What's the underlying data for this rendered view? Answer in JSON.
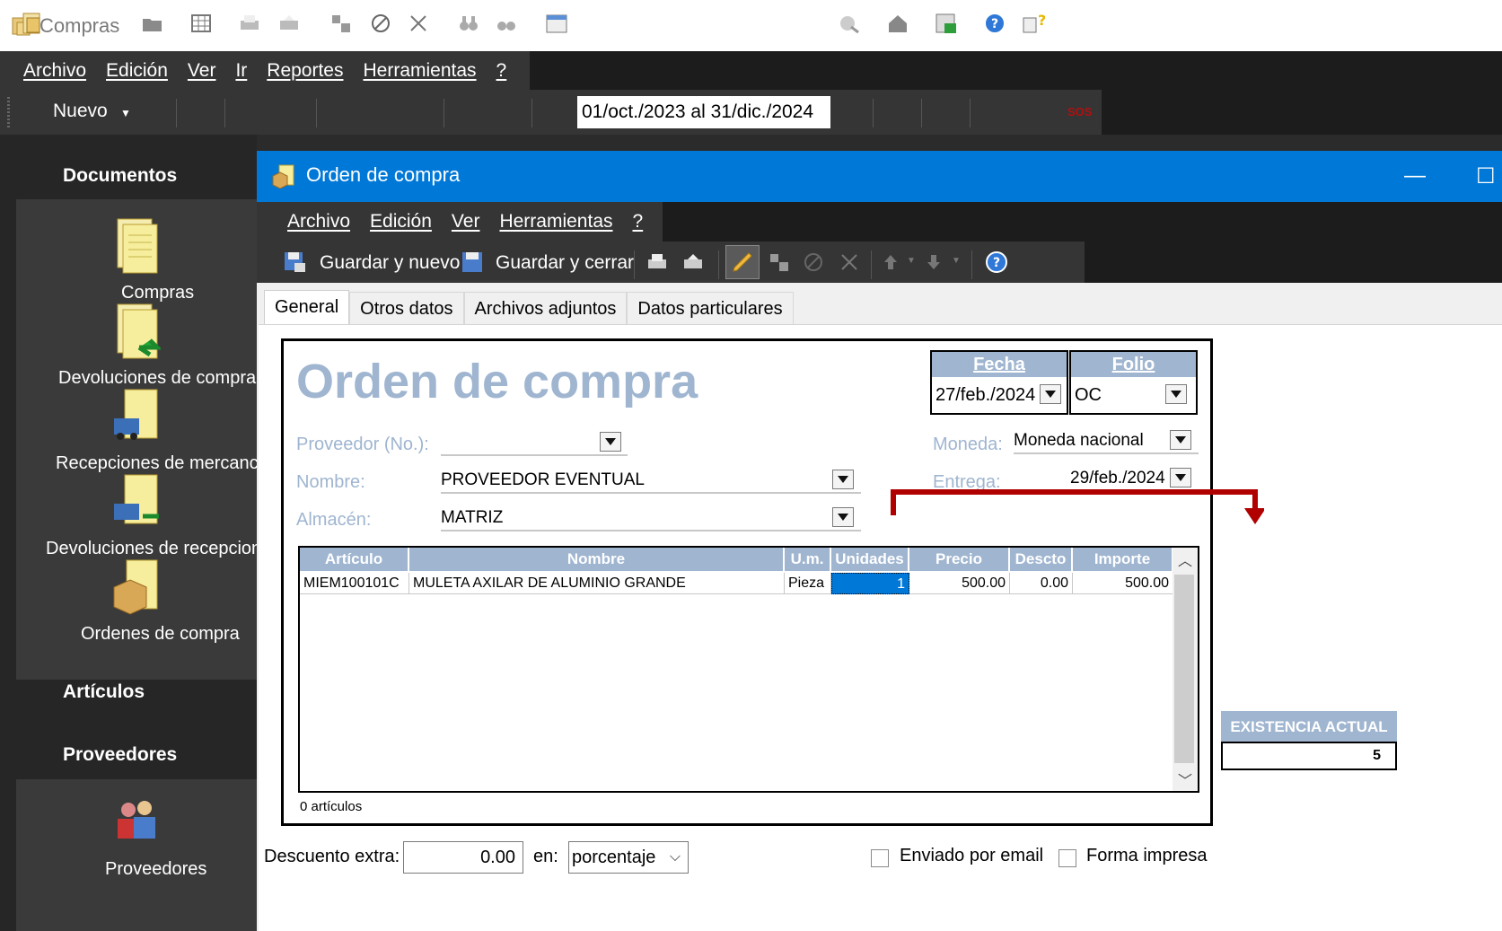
{
  "app": {
    "title": "Compras"
  },
  "main_menu": [
    "Archivo",
    "Edición",
    "Ver",
    "Ir",
    "Reportes",
    "Herramientas",
    "?"
  ],
  "main_toolbar": {
    "new_label": "Nuevo",
    "date_range": "01/oct./2023 al 31/dic./2024",
    "sos": "SOS"
  },
  "sidebar": {
    "sections": {
      "documentos": "Documentos",
      "articulos": "Artículos",
      "proveedores": "Proveedores"
    },
    "documentos_items": [
      {
        "label": "Compras",
        "icon": "document-stack-icon"
      },
      {
        "label": "Devoluciones de compra",
        "icon": "document-return-icon"
      },
      {
        "label": "Recepciones de mercancía",
        "icon": "document-truck-icon"
      },
      {
        "label": "Devoluciones de recepcion",
        "icon": "document-truck-return-icon"
      },
      {
        "label": "Ordenes de compra",
        "icon": "document-box-icon"
      }
    ],
    "proveedores_items": [
      {
        "label": "Proveedores",
        "icon": "people-icon"
      }
    ]
  },
  "child_window": {
    "title": "Orden de compra",
    "menu": [
      "Archivo",
      "Edición",
      "Ver",
      "Herramientas",
      "?"
    ],
    "toolbar": {
      "save_new": "Guardar y nuevo",
      "save_close": "Guardar y cerrar"
    },
    "tabs": [
      "General",
      "Otros datos",
      "Archivos adjuntos",
      "Datos particulares"
    ],
    "active_tab": "General"
  },
  "form": {
    "doc_title": "Orden de compra",
    "fecha": {
      "label": "Fecha",
      "value": "27/feb./2024"
    },
    "folio": {
      "label": "Folio",
      "value": "OC"
    },
    "proveedor": {
      "label": "Proveedor (No.):",
      "value": ""
    },
    "nombre": {
      "label": "Nombre:",
      "value": "PROVEEDOR EVENTUAL"
    },
    "almacen": {
      "label": "Almacén:",
      "value": "MATRIZ"
    },
    "moneda": {
      "label": "Moneda:",
      "value": "Moneda nacional"
    },
    "entrega": {
      "label": "Entrega:",
      "value": "29/feb./2024"
    }
  },
  "grid": {
    "columns": [
      "Artículo",
      "Nombre",
      "U.m.",
      "Unidades",
      "Precio",
      "Descto",
      "Importe"
    ],
    "rows": [
      {
        "articulo": "MIEM100101C",
        "nombre": "MULETA AXILAR DE ALUMINIO GRANDE",
        "um": "Pieza",
        "unidades": "1",
        "precio": "500.00",
        "descto": "0.00",
        "importe": "500.00"
      }
    ],
    "count_label": "0 artículos"
  },
  "existencia": {
    "label": "EXISTENCIA ACTUAL",
    "value": "5"
  },
  "footer": {
    "descuento_label": "Descuento extra:",
    "descuento_value": "0.00",
    "en_label": "en:",
    "en_value": "porcentaje",
    "email_label": "Enviado por email",
    "impresa_label": "Forma impresa"
  },
  "colors": {
    "accent_header": "#9fb5d0",
    "titlebar": "#0078d7",
    "arrow": "#b00000"
  }
}
